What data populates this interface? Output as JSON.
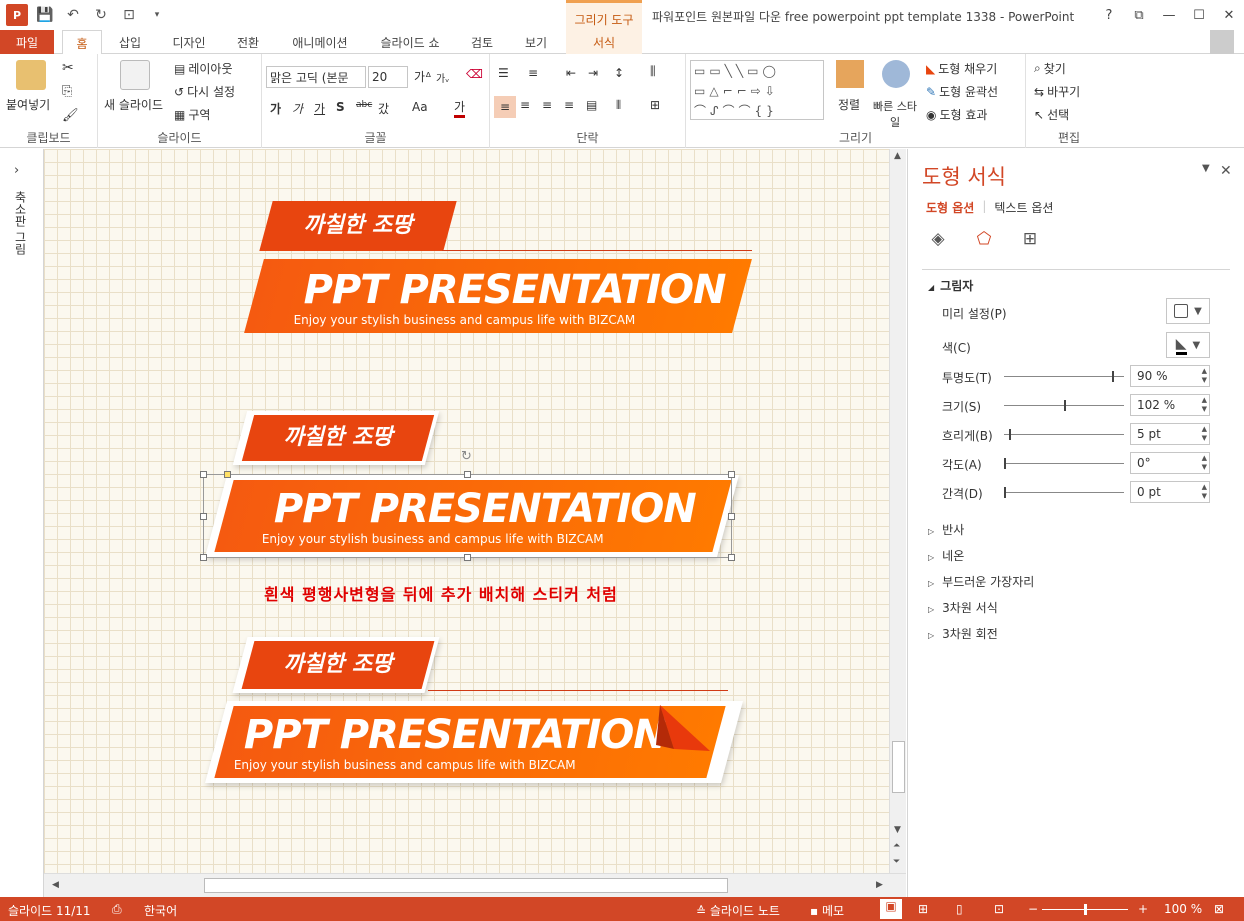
{
  "app": {
    "title": "파워포인트 원본파일 다운 free powerpoint ppt template 1338 - PowerPoint",
    "context_tab_header": "그리기 도구",
    "window_buttons": [
      "?",
      "⧉",
      "—",
      "☐",
      "✕"
    ]
  },
  "tabs": [
    "파일",
    "홈",
    "삽입",
    "디자인",
    "전환",
    "애니메이션",
    "슬라이드 쇼",
    "검토",
    "보기",
    "서식"
  ],
  "ribbon": {
    "clipboard": {
      "label": "클립보드",
      "paste": "붙여넣기"
    },
    "slides": {
      "label": "슬라이드",
      "new_slide": "새 슬라이드",
      "layout": "레이아웃",
      "reset": "다시 설정",
      "section": "구역"
    },
    "font": {
      "label": "글꼴",
      "font_name": "맑은 고딕 (본문",
      "font_size": "20",
      "bold": "가",
      "italic": "가",
      "underline": "가",
      "shadow": "S",
      "strike": "abc",
      "spacing": "갔",
      "case": "Aa",
      "color": "가"
    },
    "paragraph": {
      "label": "단락"
    },
    "drawing": {
      "label": "그리기",
      "arrange": "정렬",
      "quick_styles": "빠른 스타일",
      "fill": "도형 채우기",
      "outline": "도형 윤곽선",
      "effects": "도형 효과"
    },
    "editing": {
      "label": "편집",
      "find": "찾기",
      "replace": "바꾸기",
      "select": "선택"
    }
  },
  "left_pane": {
    "label": "축소판 그림"
  },
  "slide": {
    "banners": [
      {
        "small": "까칠한 조땅",
        "big": "PPT PRESENTATION",
        "sub": "Enjoy your stylish business and campus life with BIZCAM"
      },
      {
        "small": "까칠한 조땅",
        "big": "PPT PRESENTATION",
        "sub": "Enjoy your stylish business and campus life with BIZCAM"
      },
      {
        "small": "까칠한 조땅",
        "big": "PPT PRESENTATION",
        "sub": "Enjoy your stylish business and campus life with BIZCAM"
      }
    ],
    "caption": "흰색 평행사변형을 뒤에 추가 배치해 스티커 처럼"
  },
  "format_pane": {
    "title": "도형 서식",
    "tab_shape": "도형 옵션",
    "tab_text": "텍스트 옵션",
    "section_shadow": "그림자",
    "preset": "미리 설정(P)",
    "color": "색(C)",
    "rows": [
      {
        "label": "투명도(T)",
        "value": "90 %",
        "level": 0.9
      },
      {
        "label": "크기(S)",
        "value": "102 %",
        "level": 0.5
      },
      {
        "label": "흐리게(B)",
        "value": "5 pt",
        "level": 0.04
      },
      {
        "label": "각도(A)",
        "value": "0°",
        "level": 0
      },
      {
        "label": "간격(D)",
        "value": "0 pt",
        "level": 0
      }
    ],
    "collapsed": [
      "반사",
      "네온",
      "부드러운 가장자리",
      "3차원 서식",
      "3차원 회전"
    ]
  },
  "status": {
    "slide": "슬라이드 11/11",
    "lang": "한국어",
    "notes": "슬라이드 노트",
    "comments": "메모",
    "zoom": "100 %"
  }
}
